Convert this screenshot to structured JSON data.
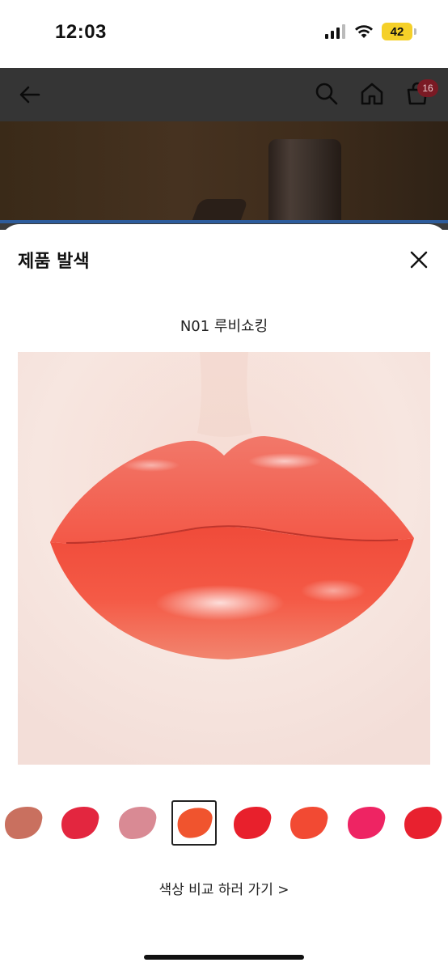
{
  "status_bar": {
    "time": "12:03",
    "battery": "42"
  },
  "header": {
    "cart_count": "16"
  },
  "sheet": {
    "title": "제품 발색",
    "shade_name": "N01 루비쇼킹",
    "compare_link": "색상 비교 하러 가기 >",
    "swatches": [
      {
        "color": "#c9705f"
      },
      {
        "color": "#e3263f"
      },
      {
        "color": "#d98a94"
      },
      {
        "color": "#f0542e",
        "selected": true
      },
      {
        "color": "#e8202c"
      },
      {
        "color": "#f24a33"
      },
      {
        "color": "#ee2463"
      },
      {
        "color": "#e8212f"
      }
    ]
  },
  "colors": {
    "header_bg": "#353535",
    "accent_strip": "#2d5c9c",
    "lip_color": "#f45a46"
  }
}
